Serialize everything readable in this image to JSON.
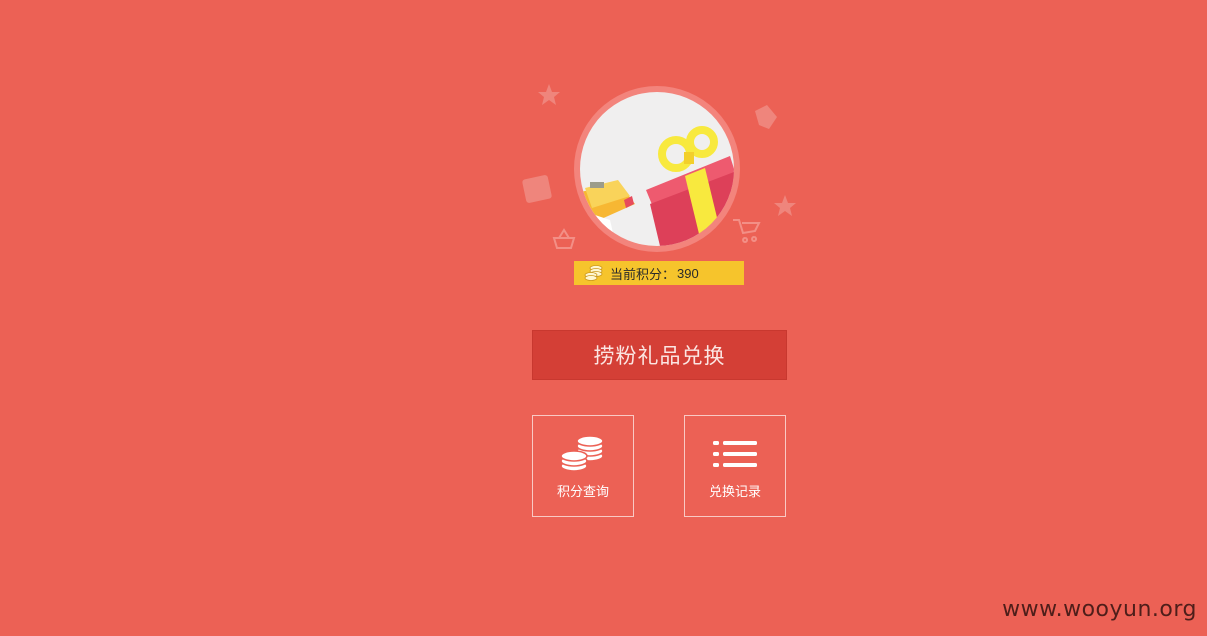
{
  "points": {
    "label": "当前积分：",
    "value": "390"
  },
  "exchange_button": {
    "label": "捞粉礼品兑换"
  },
  "tiles": [
    {
      "label": "积分查询",
      "icon": "coins-icon"
    },
    {
      "label": "兑换记录",
      "icon": "list-icon"
    }
  ],
  "watermark": "www.wooyun.org",
  "colors": {
    "background": "#ec6155",
    "button": "#d43f36",
    "points_bar": "#f6c42c"
  }
}
